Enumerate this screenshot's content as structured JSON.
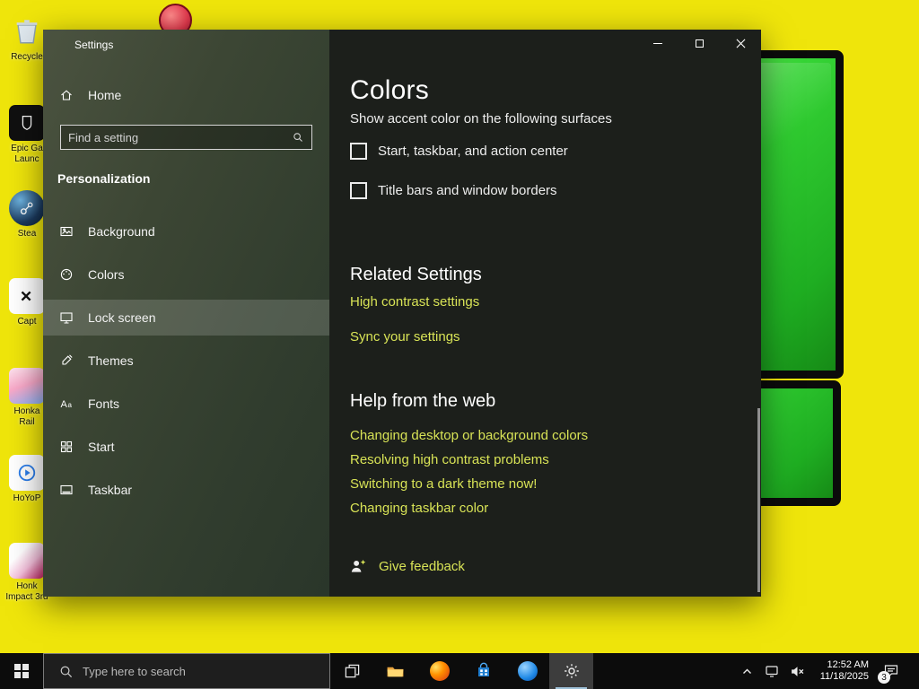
{
  "colors": {
    "accent": "#d8e356",
    "desktop_yellow": "#efe50b",
    "tetris_green": "#35d435",
    "sidebar_green": "#3c4634",
    "content_bg": "#1c1f1b"
  },
  "icons": {
    "window_controls": [
      "minimize-icon",
      "maximize-icon",
      "close-icon"
    ],
    "sidebar": [
      "home-icon",
      "search-icon",
      "background-icon",
      "colors-icon",
      "lock-screen-icon",
      "themes-icon",
      "fonts-icon",
      "start-grid-icon",
      "taskbar-icon"
    ],
    "content": [
      "feedback-icon"
    ],
    "taskbar": [
      "windows-start-icon",
      "search-icon",
      "task-view-icon",
      "file-explorer-icon",
      "firefox-icon",
      "store-icon",
      "blue-app-icon",
      "settings-gear-icon",
      "chevron-up-icon",
      "monitor-icon",
      "volume-muted-icon",
      "action-center-icon"
    ]
  },
  "desktop": {
    "icons": [
      {
        "name": "recycle-bin",
        "line1": "Recycle",
        "line2": ""
      },
      {
        "name": "epic-games-launcher",
        "line1": "Epic Ga",
        "line2": "Launc"
      },
      {
        "name": "steam",
        "line1": "Stea",
        "line2": ""
      },
      {
        "name": "capcut",
        "line1": "Capt",
        "line2": ""
      },
      {
        "name": "honkai-star-rail",
        "line1": "Honka",
        "line2": "Rail"
      },
      {
        "name": "hoyoplay",
        "line1": "HoYoP",
        "line2": ""
      },
      {
        "name": "honkai-impact-3rd",
        "line1": "Honk",
        "line2": "Impact 3rd"
      }
    ]
  },
  "window": {
    "title": "Settings"
  },
  "sidebar": {
    "home_label": "Home",
    "search_placeholder": "Find a setting",
    "section_heading": "Personalization",
    "selected_item": "Lock screen",
    "items": [
      {
        "label": "Background"
      },
      {
        "label": "Colors"
      },
      {
        "label": "Lock screen"
      },
      {
        "label": "Themes"
      },
      {
        "label": "Fonts"
      },
      {
        "label": "Start"
      },
      {
        "label": "Taskbar"
      }
    ]
  },
  "content": {
    "page_title": "Colors",
    "accent_surfaces_label": "Show accent color on the following surfaces",
    "checkboxes": [
      {
        "label": "Start, taskbar, and action center",
        "checked": false
      },
      {
        "label": "Title bars and window borders",
        "checked": false
      }
    ],
    "related_heading": "Related Settings",
    "related_links": [
      "High contrast settings",
      "Sync your settings"
    ],
    "help_heading": "Help from the web",
    "help_links": [
      "Changing desktop or background colors",
      "Resolving high contrast problems",
      "Switching to a dark theme now!",
      "Changing taskbar color"
    ],
    "feedback_label": "Give feedback"
  },
  "taskbar": {
    "search_placeholder": "Type here to search",
    "clock_time": "12:52 AM",
    "clock_date": "11/18/2025",
    "notification_badge": "3"
  }
}
